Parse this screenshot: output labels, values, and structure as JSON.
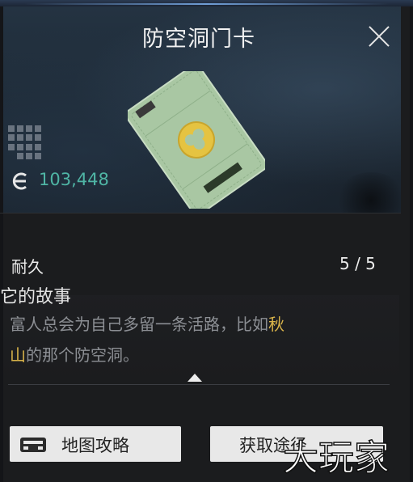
{
  "window": {
    "title": "防空洞门卡"
  },
  "item": {
    "price": "103,448",
    "icons": {
      "close": "close-icon",
      "grid": "grid-icon",
      "currency": "currency-icon",
      "card": "keycard-image"
    }
  },
  "stats": {
    "durability_label": "耐久",
    "durability_value": "5 / 5"
  },
  "story": {
    "title": "它的故事",
    "text_part1": "富人总会为自己多留一条活路，比如",
    "highlight1": "秋",
    "highlight2": "山",
    "text_part2": "的那个防空洞。"
  },
  "buttons": {
    "map_guide": "地图攻略",
    "obtain": "获取途径"
  },
  "colors": {
    "price": "#4fb5a5",
    "highlight": "#d9b44a",
    "hero_bg": "#1e2a36",
    "button_bg": "#e8e8e8"
  },
  "watermark": {
    "text": "大玩家"
  }
}
